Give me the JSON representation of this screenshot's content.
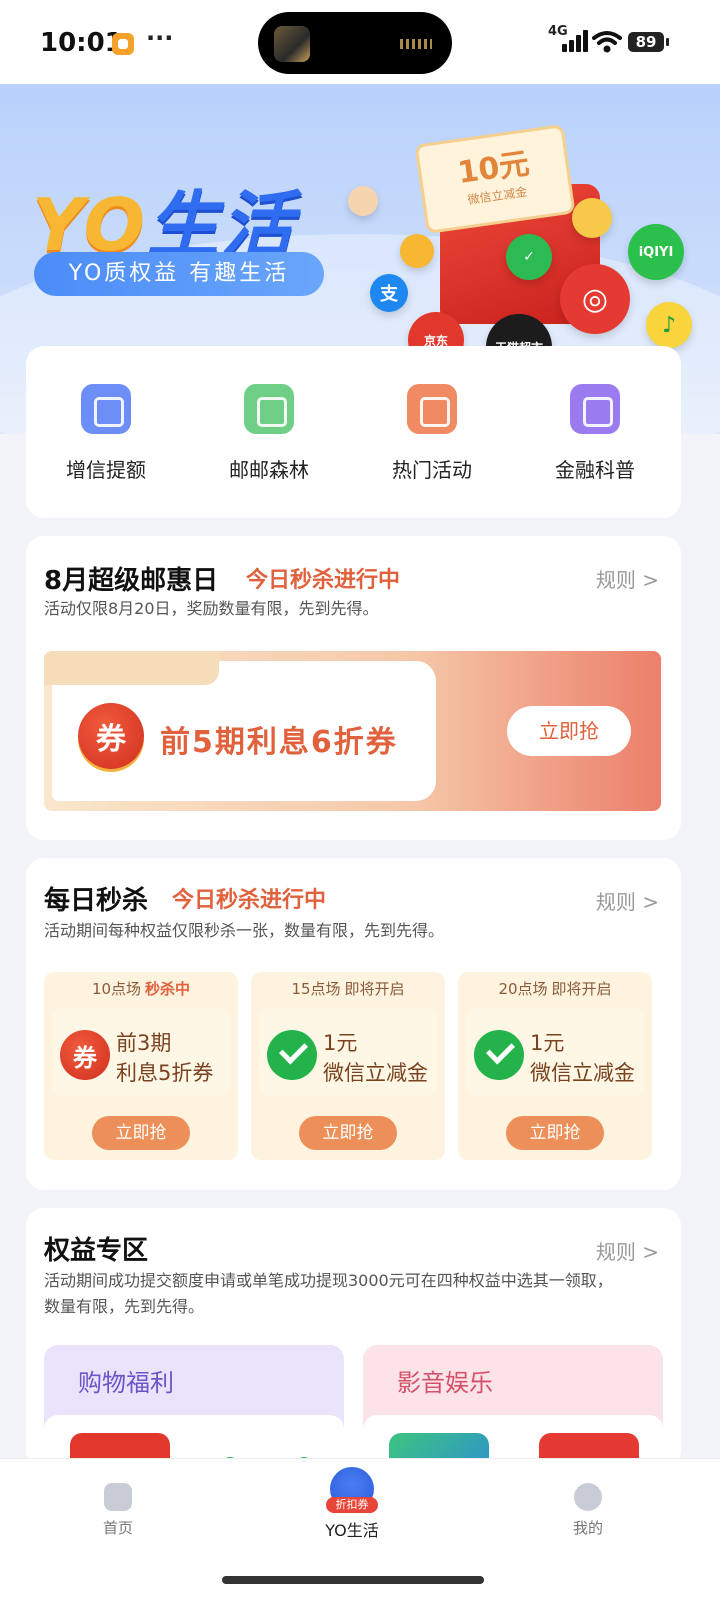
{
  "status": {
    "time": "10:01",
    "dots": "···",
    "network": "4G",
    "battery": "89"
  },
  "hero": {
    "title_yo": "YO",
    "title_cn": "生活",
    "slogan": "YO质权益 有趣生活",
    "coupon_amount": "10元",
    "coupon_sub": "微信立减金",
    "tmall": "天猫超市",
    "jd": "京东"
  },
  "quick_menu": [
    {
      "label": "增信提额",
      "icon": "wallet-icon",
      "color": "#6d8ef6"
    },
    {
      "label": "邮邮森林",
      "icon": "co2-cloud-icon",
      "color": "#6fcf86"
    },
    {
      "label": "热门活动",
      "icon": "bookmark-star-icon",
      "color": "#f08a63"
    },
    {
      "label": "金融科普",
      "icon": "finance-doc-icon",
      "color": "#9a7cf0"
    }
  ],
  "super_day": {
    "title": "8月超级邮惠日",
    "tag": "今日秒杀进行中",
    "rule": "规则 >",
    "desc": "活动仅限8月20日，奖励数量有限，先到先得。",
    "coupon_icon": "券",
    "coupon_title": "前5期利息6折券",
    "button": "立即抢"
  },
  "daily": {
    "title": "每日秒杀",
    "tag": "今日秒杀进行中",
    "rule": "规则 >",
    "desc": "活动期间每种权益仅限秒杀一张，数量有限，先到先得。",
    "items": [
      {
        "session": "10点场",
        "state": "秒杀中",
        "line1": "前3期",
        "line2": "利息5折券",
        "icon": "券",
        "button": "立即抢"
      },
      {
        "session": "15点场",
        "state": "即将开启",
        "line1": "1元",
        "line2": "微信立减金",
        "icon": "",
        "button": "立即抢"
      },
      {
        "session": "20点场",
        "state": "即将开启",
        "line1": "1元",
        "line2": "微信立减金",
        "icon": "",
        "button": "立即抢"
      }
    ]
  },
  "rights": {
    "title": "权益专区",
    "rule": "规则 >",
    "desc1": "活动期间成功提交额度申请或单笔成功提现3000元可在四种权益中选其一领取，",
    "desc2": "数量有限，先到先得。",
    "boxes": [
      {
        "label": "购物福利"
      },
      {
        "label": "影音娱乐"
      }
    ]
  },
  "tabbar": {
    "home": "首页",
    "yo": "YO生活",
    "yo_badge": "折扣券",
    "mine": "我的"
  }
}
